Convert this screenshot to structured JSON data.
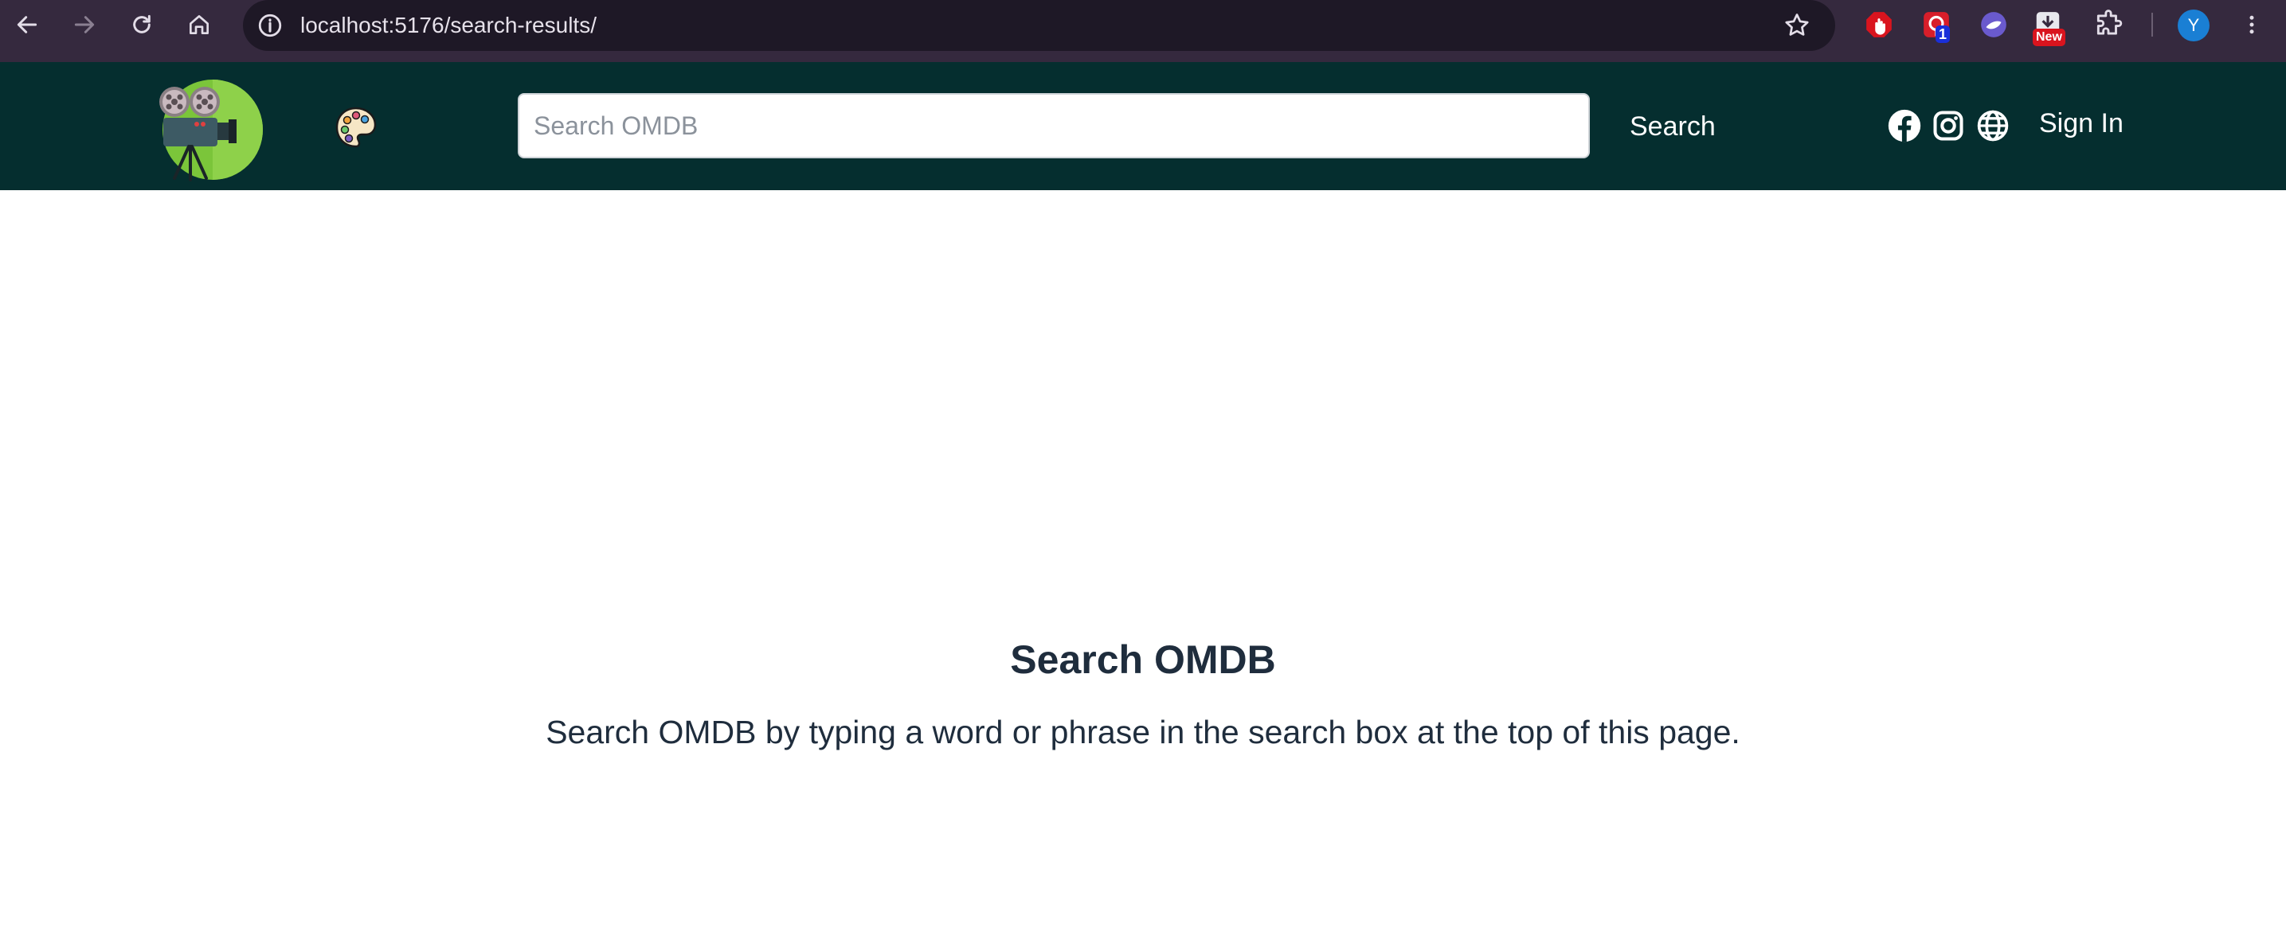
{
  "browser": {
    "url": "localhost:5176/search-results/",
    "extensions": [
      {
        "name": "adblock-extension"
      },
      {
        "name": "pinner-extension",
        "badge": "1"
      },
      {
        "name": "sphere-extension"
      },
      {
        "name": "new-extension",
        "badge": "New"
      }
    ],
    "profile_initial": "Y"
  },
  "header": {
    "search_placeholder": "Search OMDB",
    "search_value": "",
    "search_button_label": "Search",
    "signin_label": "Sign In"
  },
  "main": {
    "title": "Search OMDB",
    "description": "Search OMDB by typing a word or phrase in the search box at the top of this page."
  },
  "colors": {
    "chrome_bg": "#35293e",
    "nav_bg": "#052e2f",
    "text_dark": "#1f2d3d"
  }
}
